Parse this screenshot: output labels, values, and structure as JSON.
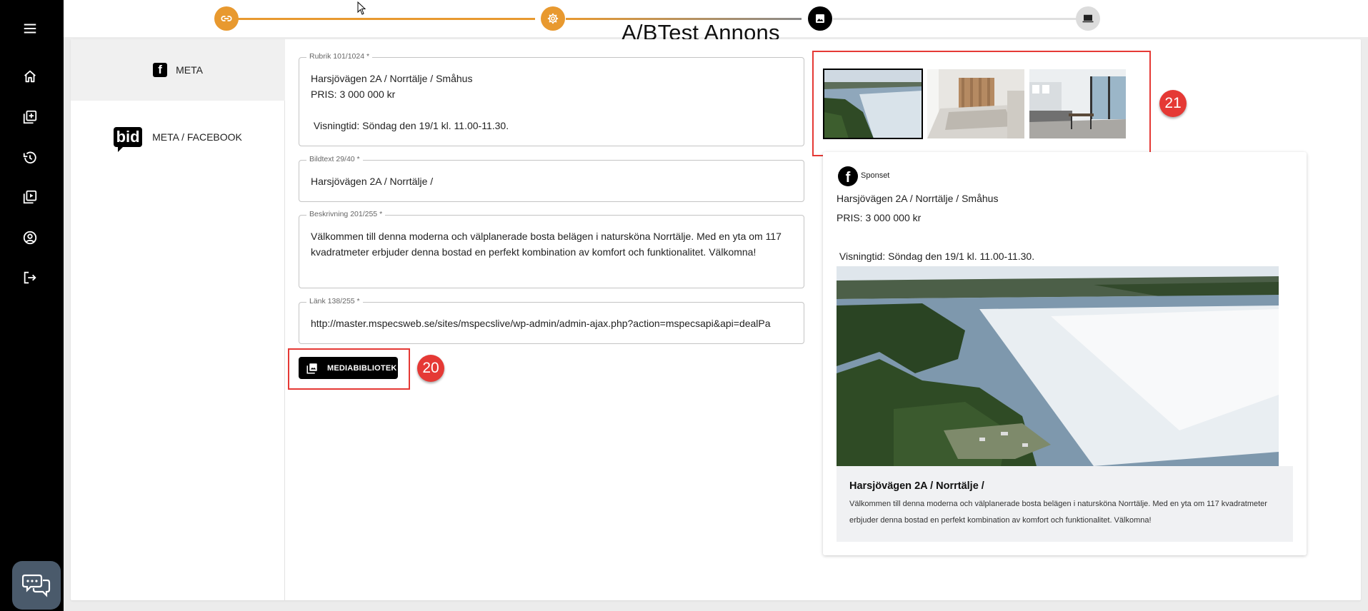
{
  "header": {
    "title": "A/BTest Annons"
  },
  "nav": {
    "items": [
      {
        "label": "META"
      },
      {
        "label": "META / FACEBOOK",
        "logo_text": "bid"
      }
    ]
  },
  "fields": {
    "rubrik": {
      "label": "Rubrik 101/1024 *",
      "value": "Harsjövägen 2A / Norrtälje / Småhus\nPRIS: 3 000 000 kr\n\n Visningtid: Söndag den 19/1 kl. 11.00-11.30."
    },
    "bildtext": {
      "label": "Bildtext 29/40 *",
      "value": "Harsjövägen 2A / Norrtälje /"
    },
    "beskrivning": {
      "label": "Beskrivning 201/255 *",
      "value": "Välkommen till denna moderna och välplanerade bosta belägen i natursköna Norrtälje. Med en yta om 117 kvadratmeter erbjuder denna bostad en perfekt kombination av komfort och funktionalitet. Välkomna!"
    },
    "lank": {
      "label": "Länk 138/255 *",
      "value": "http://master.mspecsweb.se/sites/mspecslive/wp-admin/admin-ajax.php?action=mspecsapi&api=dealPa"
    }
  },
  "media_button": {
    "label": "MEDIABIBLIOTEK"
  },
  "annotations": {
    "badge_20": "20",
    "badge_21": "21"
  },
  "preview": {
    "sponsored": "Sponset",
    "text": "Harsjövägen 2A / Norrtälje / Småhus\nPRIS: 3 000 000 kr\n\n Visningtid: Söndag den 19/1 kl. 11.00-11.30.",
    "caption_title": "Harsjövägen 2A / Norrtälje /",
    "caption_desc": "Välkommen till denna moderna och välplanerade bosta belägen i natursköna Norrtälje. Med en yta om 117 kvadratmeter erbjuder denna bostad en perfekt kombination av komfort och funktionalitet. Välkomna!"
  },
  "stepper": {
    "steps": [
      {
        "icon": "link-icon",
        "state": "done"
      },
      {
        "icon": "gear-icon",
        "state": "done"
      },
      {
        "icon": "image-icon",
        "state": "active"
      },
      {
        "icon": "monitor-icon",
        "state": "pending"
      }
    ]
  },
  "colors": {
    "accent": "#e8992f",
    "annotation": "#e53935",
    "sidebar": "#000000"
  }
}
